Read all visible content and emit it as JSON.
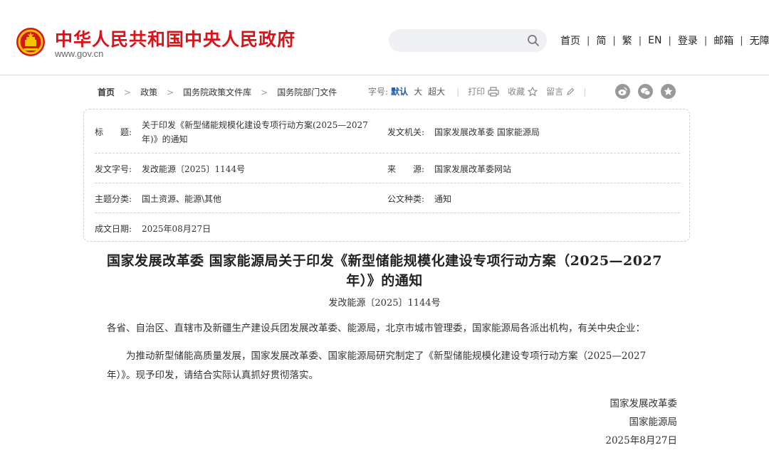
{
  "header": {
    "site_title": "中华人民共和国中央人民政府",
    "site_url": "www.gov.cn",
    "search": {
      "placeholder": ""
    },
    "nav": [
      "首页",
      "简",
      "繁",
      "EN",
      "登录",
      "邮箱",
      "无障碍"
    ]
  },
  "breadcrumb": [
    "首页",
    "政策",
    "国务院政策文件库",
    "国务院部门文件"
  ],
  "tools": {
    "font_size_label": "字号:",
    "font_sizes": [
      "默认",
      "大",
      "超大"
    ],
    "print": "打印",
    "favorite": "收藏",
    "comment": "留言"
  },
  "share_icons": [
    "weibo-icon",
    "wechat-icon",
    "star-badge-icon"
  ],
  "info": {
    "title_label": "标　　题:",
    "title_value": "关于印发《新型储能规模化建设专项行动方案(2025—2027年)》的通知",
    "issuer_label": "发文机关:",
    "issuer_value": "国家发展改革委 国家能源局",
    "doc_no_label": "发文字号:",
    "doc_no_value": "发改能源〔2025〕1144号",
    "source_label": "来　　源:",
    "source_value": "国家发展改革委网站",
    "topic_label": "主题分类:",
    "topic_value": "国土资源、能源\\其他",
    "type_label": "公文种类:",
    "type_value": "通知",
    "date_label": "成文日期:",
    "date_value": "2025年08月27日"
  },
  "article": {
    "title": "国家发展改革委 国家能源局关于印发《新型储能规模化建设专项行动方案（2025—2027年）》的通知",
    "doc_number": "发改能源〔2025〕1144号",
    "recipients": "各省、自治区、直辖市及新疆生产建设兵团发展改革委、能源局，北京市城市管理委，国家能源局各派出机构，有关中央企业：",
    "body": "为推动新型储能高质量发展，国家发展改革委、国家能源局研究制定了《新型储能规模化建设专项行动方案（2025—2027年）》。现予印发，请结合实际认真抓好贯彻落实。",
    "signatories": [
      "国家发展改革委",
      "国家能源局"
    ],
    "sign_date": "2025年8月27日"
  },
  "colors": {
    "brand_red": "#d7141a",
    "active_blue": "#1f5aa8"
  }
}
